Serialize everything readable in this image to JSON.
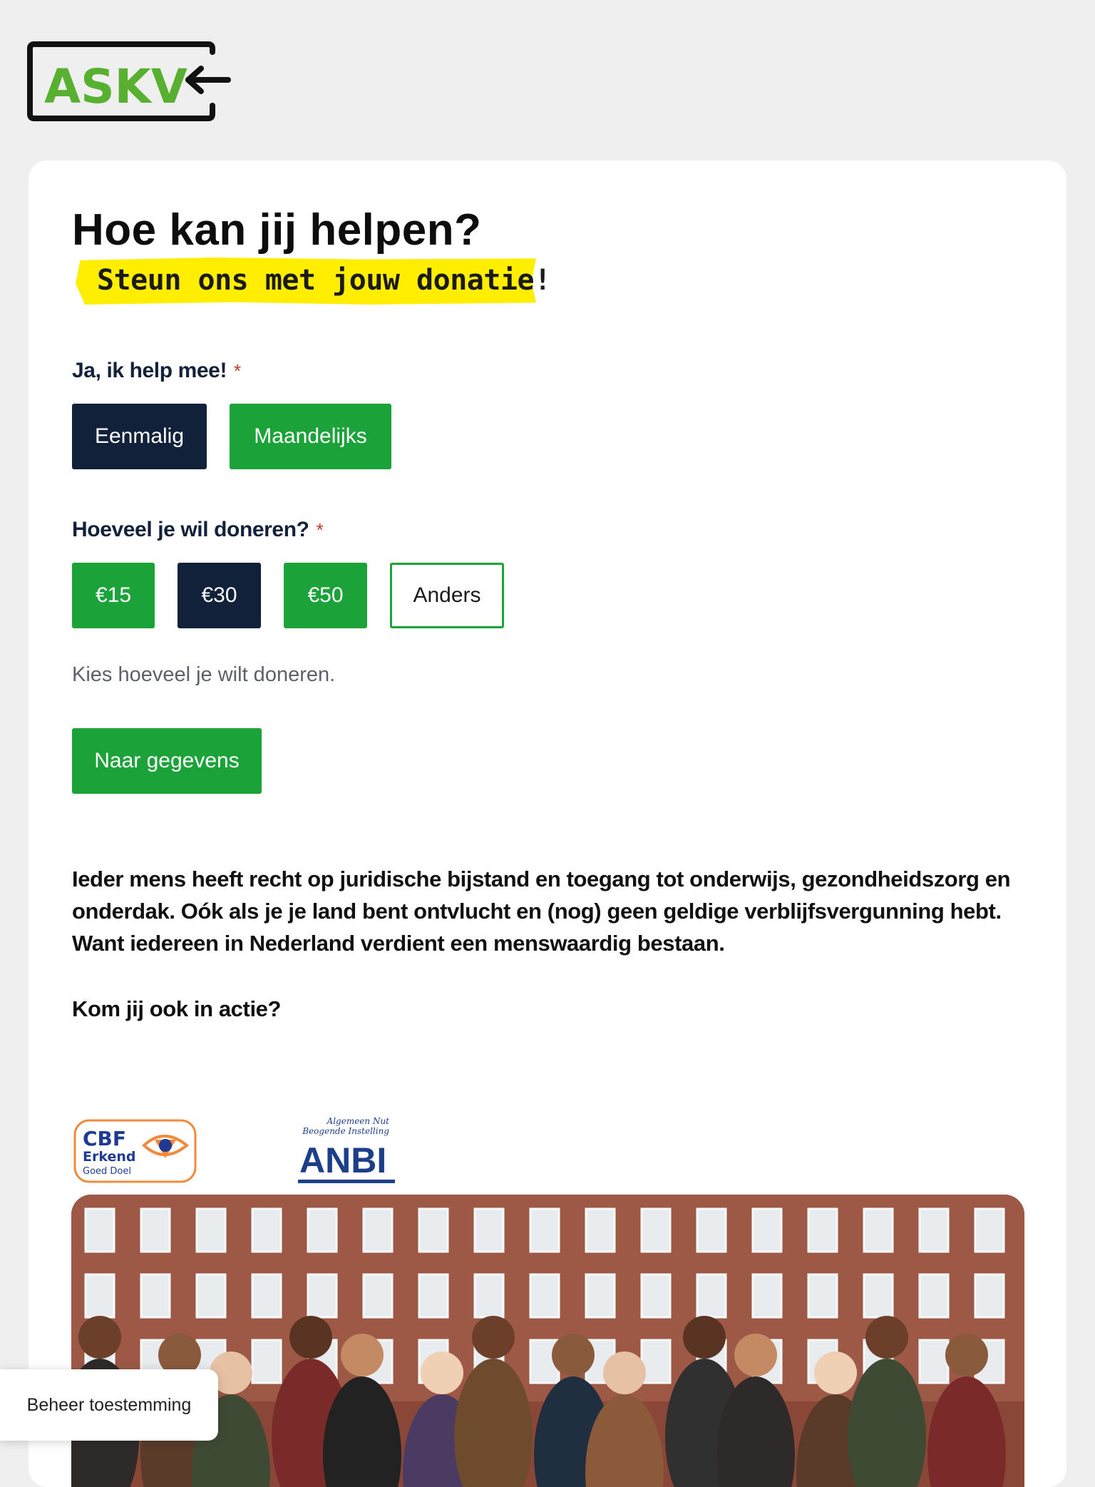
{
  "logo": {
    "text": "ASKV",
    "icon": "arrow-left-icon",
    "color": "#57b030"
  },
  "form": {
    "title": "Hoe kan jij helpen?",
    "subtitle": "Steun ons met jouw donatie!",
    "frequency": {
      "label": "Ja, ik help mee!",
      "required_mark": "*",
      "options": [
        "Eenmalig",
        "Maandelijks"
      ],
      "selected": "Eenmalig"
    },
    "amount": {
      "label": "Hoeveel je wil doneren?",
      "required_mark": "*",
      "options": [
        "€15",
        "€30",
        "€50",
        "Anders"
      ],
      "selected": "€30",
      "hint": "Kies hoeveel je wilt doneren."
    },
    "submit_label": "Naar gegevens"
  },
  "content": {
    "body": "Ieder mens heeft recht op juridische bijstand en toegang tot onderwijs, gezondheidszorg en onderdak. Oók als je je land bent ontvlucht en (nog) geen geldige verblijfsvergunning hebt. Want iedereen in Nederland verdient een menswaardig bestaan.",
    "cta": "Kom jij ook in actie?"
  },
  "badges": {
    "cbf": {
      "line1": "CBF",
      "line2": "Erkend",
      "line3": "Goed Doel"
    },
    "anbi": {
      "line1": "Algemeen Nut",
      "line2": "Beogende Instelling",
      "line3": "ANBI"
    }
  },
  "consent_button": "Beheer toestemming",
  "colors": {
    "accent_green": "#1ba33a",
    "dark_navy": "#12213a",
    "highlight_yellow": "#ffee00",
    "background": "#efeff0"
  }
}
